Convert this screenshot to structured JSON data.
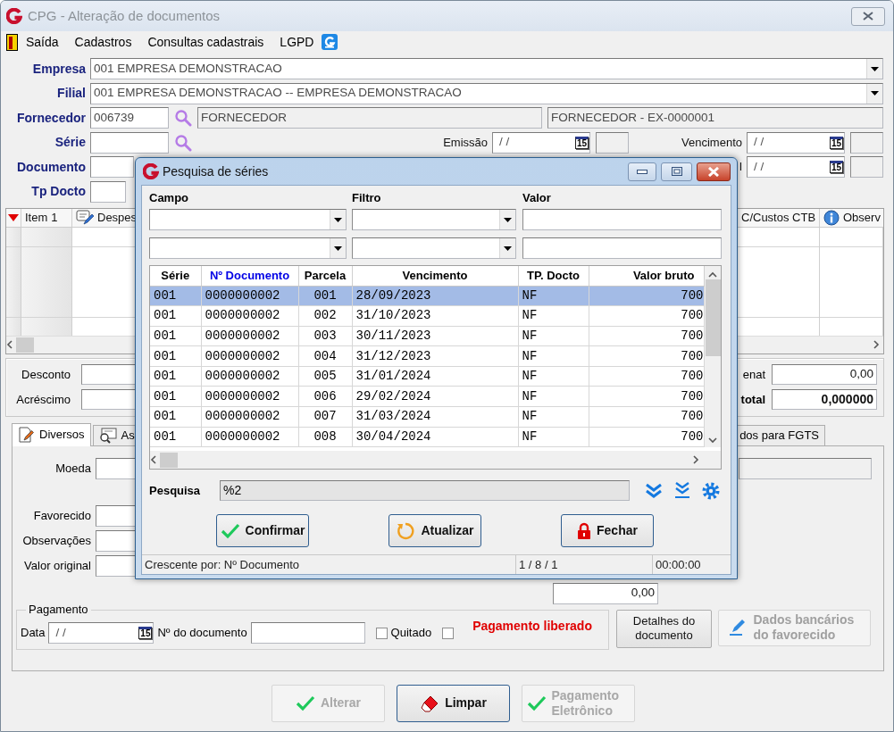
{
  "window": {
    "title": "CPG - Alteração de documentos"
  },
  "menu": [
    {
      "label": "Saída"
    },
    {
      "label": "Cadastros"
    },
    {
      "label": "Consultas cadastrais"
    },
    {
      "label": "LGPD"
    }
  ],
  "form": {
    "empresa": {
      "label": "Empresa",
      "value": "001 EMPRESA DEMONSTRACAO"
    },
    "filial": {
      "label": "Filial",
      "value": "001 EMPRESA DEMONSTRACAO -- EMPRESA DEMONSTRACAO"
    },
    "fornecedor": {
      "label": "Fornecedor",
      "code": "006739",
      "name": "FORNECEDOR",
      "description": "FORNECEDOR - EX-0000001"
    },
    "serie": {
      "label": "Série"
    },
    "emissao": {
      "label": "Emissão",
      "value": "/ /",
      "calendar": "15"
    },
    "vencimento": {
      "label": "Vencimento",
      "value": "/ /",
      "calendar": "15"
    },
    "documento": {
      "label": "Documento"
    },
    "date_2": {
      "label": "l",
      "value": "/ /",
      "calendar": "15"
    },
    "tp_docto": {
      "label": "Tp Docto"
    }
  },
  "items_grid": {
    "sort_index": "1",
    "columns": [
      {
        "label": "Item"
      },
      {
        "label": "Despes"
      },
      {
        "label": "C/Custos CTB"
      },
      {
        "label": "Observ"
      }
    ]
  },
  "totals": {
    "desconto": {
      "label": "Desconto"
    },
    "acrescimo": {
      "label": "Acréscimo"
    },
    "field_1": {
      "label": "enat",
      "value": "0,00"
    },
    "field_2": {
      "label": "total",
      "value": "0,000000"
    }
  },
  "tabs": [
    {
      "label": "Diversos",
      "selected": true
    },
    {
      "label": "As",
      "selected": false
    },
    {
      "label": "dos para FGTS",
      "selected": false
    }
  ],
  "diversos": {
    "moeda": "Moeda",
    "favorecido": "Favorecido",
    "observacoes": "Observações",
    "valor_original": "Valor original",
    "amount": "0,00"
  },
  "pagamento": {
    "legend": "Pagamento",
    "data": {
      "label": "Data",
      "value": "/ /",
      "calendar": "15"
    },
    "documento_label": "Nº do documento",
    "checks": [
      {
        "label": "Quitado",
        "checked": false,
        "kind": "plain"
      },
      {
        "label": "Pagamento liberado",
        "checked": false,
        "kind": "alert"
      }
    ]
  },
  "side_buttons": [
    {
      "label": "Detalhes do documento",
      "disabled": false,
      "kind": "plain"
    },
    {
      "label": "Dados bancários do favorecido",
      "disabled": true,
      "kind": "edit"
    }
  ],
  "actions": [
    {
      "label": "Alterar",
      "disabled": true,
      "kind": "confirm"
    },
    {
      "label": "Limpar",
      "disabled": false,
      "kind": "clear"
    },
    {
      "label": "Pagamento Eletrônico",
      "disabled": true,
      "kind": "confirm"
    }
  ],
  "dialog": {
    "title": "Pesquisa de séries",
    "filter_labels": [
      "Campo",
      "Filtro",
      "Valor"
    ],
    "columns": [
      {
        "label": "Série",
        "sorted": false
      },
      {
        "label": "Nº Documento",
        "sorted": true
      },
      {
        "label": "Parcela",
        "sorted": false
      },
      {
        "label": "Vencimento",
        "sorted": false
      },
      {
        "label": "TP. Docto",
        "sorted": false
      },
      {
        "label": "Valor bruto",
        "sorted": false
      }
    ],
    "rows": [
      {
        "cells": [
          "001",
          "0000000002",
          "001",
          "28/09/2023",
          "NF",
          "700"
        ],
        "selected": true
      },
      {
        "cells": [
          "001",
          "0000000002",
          "002",
          "31/10/2023",
          "NF",
          "700"
        ],
        "selected": false
      },
      {
        "cells": [
          "001",
          "0000000002",
          "003",
          "30/11/2023",
          "NF",
          "700"
        ],
        "selected": false
      },
      {
        "cells": [
          "001",
          "0000000002",
          "004",
          "31/12/2023",
          "NF",
          "700"
        ],
        "selected": false
      },
      {
        "cells": [
          "001",
          "0000000002",
          "005",
          "31/01/2024",
          "NF",
          "700"
        ],
        "selected": false
      },
      {
        "cells": [
          "001",
          "0000000002",
          "006",
          "29/02/2024",
          "NF",
          "700"
        ],
        "selected": false
      },
      {
        "cells": [
          "001",
          "0000000002",
          "007",
          "31/03/2024",
          "NF",
          "700"
        ],
        "selected": false
      },
      {
        "cells": [
          "001",
          "0000000002",
          "008",
          "30/04/2024",
          "NF",
          "700"
        ],
        "selected": false
      }
    ],
    "search": {
      "label": "Pesquisa",
      "value": "%2"
    },
    "buttons": [
      {
        "label": "Confirmar",
        "kind": "confirm"
      },
      {
        "label": "Atualizar",
        "kind": "refresh"
      },
      {
        "label": "Fechar",
        "kind": "lock"
      }
    ],
    "status": [
      "Crescente por: Nº Documento",
      "1 / 8 / 1",
      "00:00:00"
    ]
  }
}
